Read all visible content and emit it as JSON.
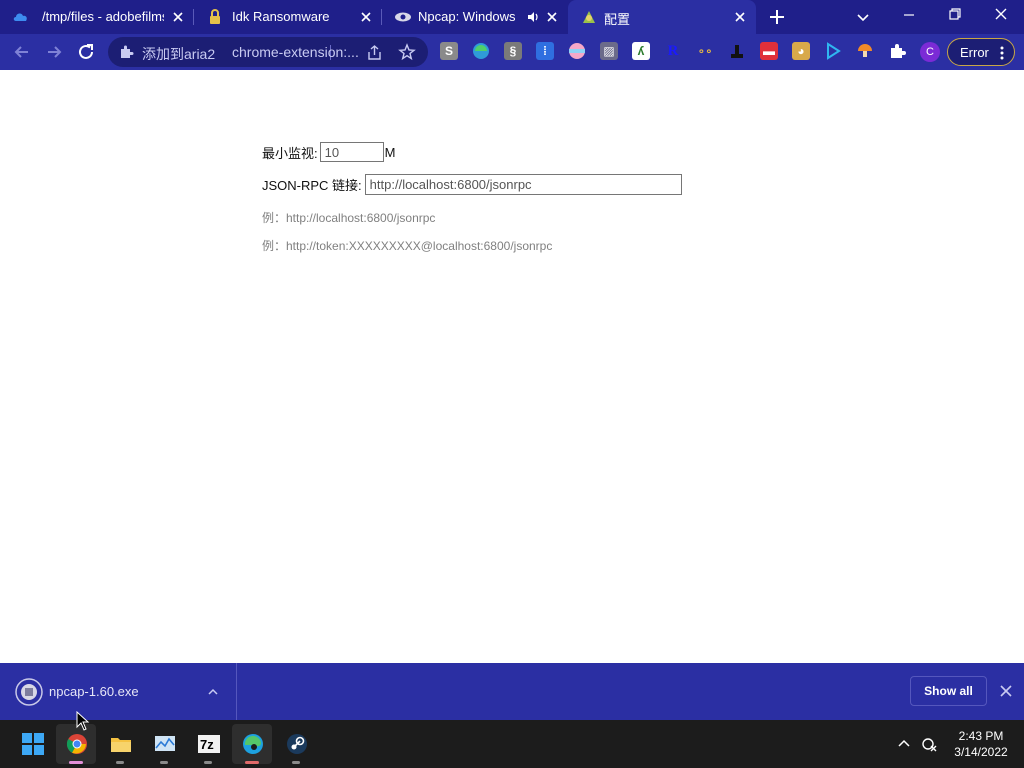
{
  "tabs": [
    {
      "title": "/tmp/files - adobefilms",
      "icon": "cloud-icon"
    },
    {
      "title": "Idk Ransomware",
      "icon": "lock-icon"
    },
    {
      "title": "Npcap: Windows P",
      "icon": "eye-icon",
      "audio": "speaker-icon"
    },
    {
      "title": "配置",
      "icon": "aria2-icon",
      "active": true
    }
  ],
  "omnibox": {
    "title": "添加到aria2",
    "url": "chrome-extension:..."
  },
  "toolbar": {
    "profile_initial": "C",
    "error_label": "Error",
    "extension_icons": [
      "s-extension-icon",
      "edge-extension-icon",
      "grid-extension-icon",
      "apps-extension-icon",
      "flag-extension-icon",
      "image-extension-icon",
      "lambda-extension-icon",
      "r-extension-icon",
      "link-extension-icon",
      "stamp-extension-icon",
      "media-extension-icon",
      "dog-extension-icon",
      "play-extension-icon",
      "mushroom-extension-icon",
      "puzzle-icon"
    ]
  },
  "form": {
    "min_monitor_label": "最小监视:",
    "min_monitor_value": "10",
    "min_monitor_unit": "M",
    "rpc_label": "JSON-RPC 链接:",
    "rpc_value": "http://localhost:6800/jsonrpc",
    "example1": "例：http://localhost:6800/jsonrpc",
    "example2": "例：http://token:XXXXXXXXX@localhost:6800/jsonrpc"
  },
  "download_shelf": {
    "file_name": "npcap-1.60.exe",
    "show_all_label": "Show all"
  },
  "taskbar": {
    "apps": [
      "windows-start-icon",
      "chrome-icon",
      "file-explorer-icon",
      "performance-monitor-icon",
      "7zip-icon",
      "edge-icon",
      "steam-icon"
    ],
    "time": "2:43 PM",
    "date": "3/14/2022"
  },
  "colors": {
    "tabstrip": "#1f1f8a",
    "toolbar": "#2b2fa3",
    "taskbar": "#1c1c1c"
  }
}
